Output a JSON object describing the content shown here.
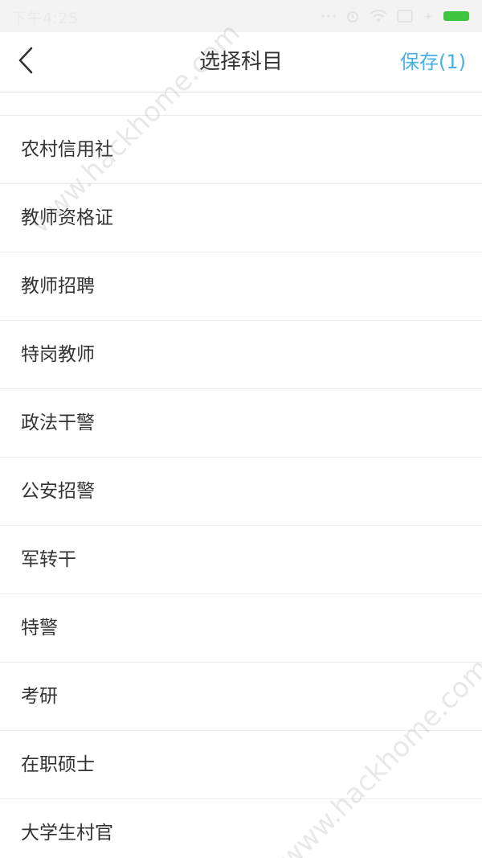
{
  "status_bar": {
    "time": "下午4:25",
    "icons": [
      "dots-icon",
      "alarm-icon",
      "wifi-icon",
      "sim-icon",
      "airplane-icon",
      "battery-icon"
    ],
    "battery_color": "#3fc43f"
  },
  "header": {
    "back_icon": "chevron-left-icon",
    "title": "选择科目",
    "save_label": "保存(1)",
    "save_color": "#46b1e6"
  },
  "subjects": [
    {
      "label": "农村信用社"
    },
    {
      "label": "教师资格证"
    },
    {
      "label": "教师招聘"
    },
    {
      "label": "特岗教师"
    },
    {
      "label": "政法干警"
    },
    {
      "label": "公安招警"
    },
    {
      "label": "军转干"
    },
    {
      "label": "特警"
    },
    {
      "label": "考研"
    },
    {
      "label": "在职硕士"
    },
    {
      "label": "大学生村官"
    }
  ],
  "watermark": {
    "text": "www.hackhome.com"
  }
}
